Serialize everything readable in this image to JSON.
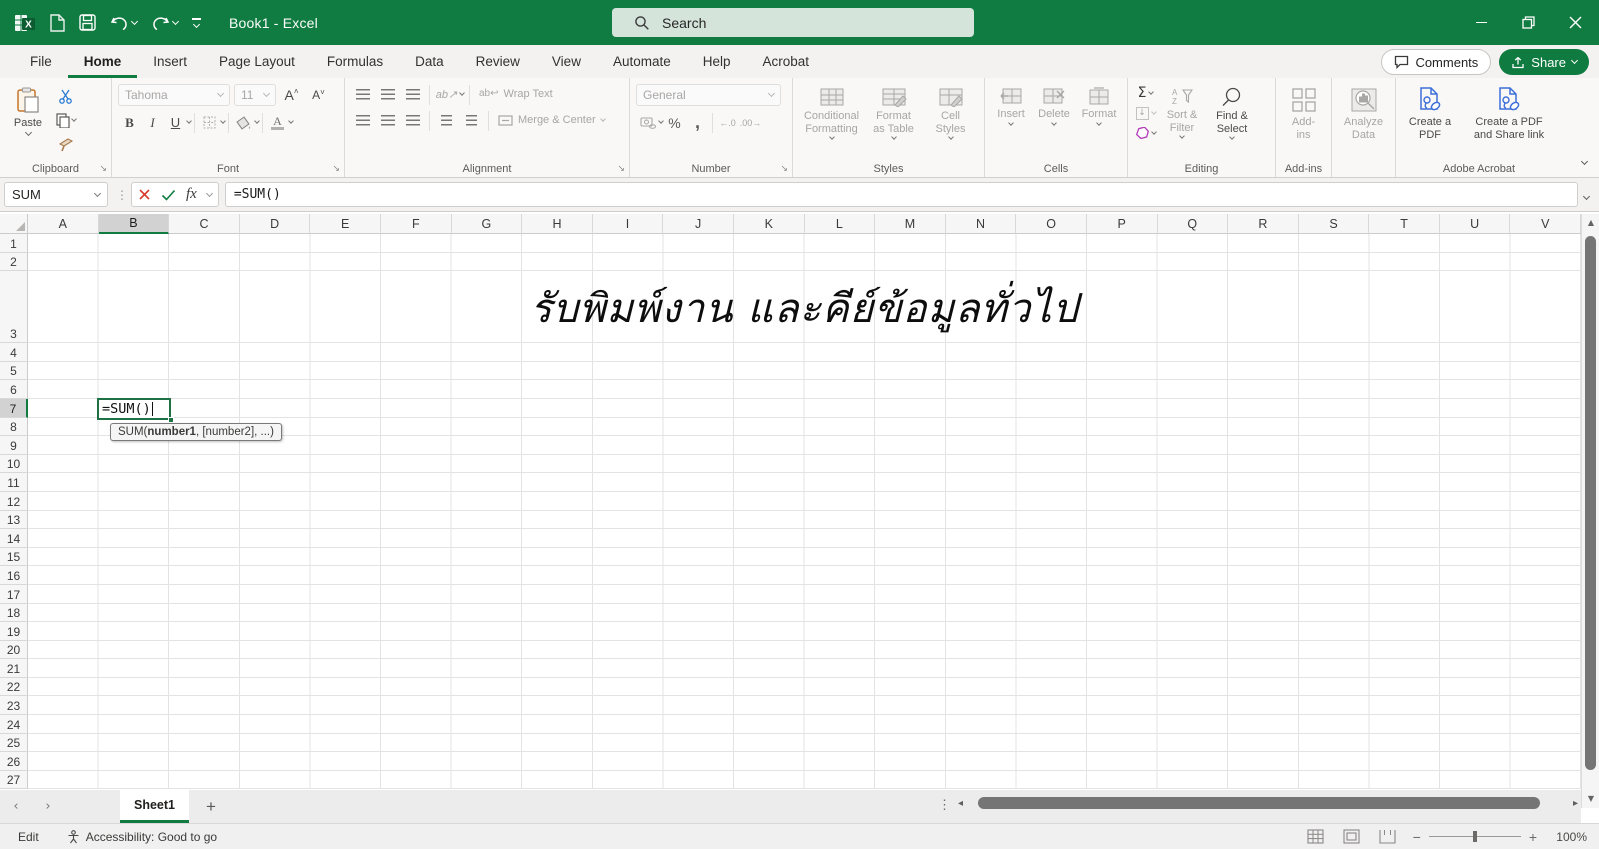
{
  "titlebar": {
    "title": "Book1 - Excel",
    "search_placeholder": "Search"
  },
  "ribbon_tabs": {
    "items": [
      "File",
      "Home",
      "Insert",
      "Page Layout",
      "Formulas",
      "Data",
      "Review",
      "View",
      "Automate",
      "Help",
      "Acrobat"
    ],
    "active": "Home"
  },
  "top_actions": {
    "comments": "Comments",
    "share": "Share"
  },
  "ribbon": {
    "clipboard": {
      "label": "Clipboard",
      "paste": "Paste"
    },
    "font": {
      "label": "Font",
      "family": "Tahoma",
      "size": "11",
      "bold": "B",
      "italic": "I",
      "underline": "U"
    },
    "alignment": {
      "label": "Alignment",
      "wrap": "Wrap Text",
      "merge": "Merge & Center"
    },
    "number": {
      "label": "Number",
      "format": "General",
      "percent": "%",
      "comma": ","
    },
    "styles": {
      "label": "Styles",
      "conditional": "Conditional Formatting",
      "format_table": "Format as Table",
      "cell_styles": "Cell Styles"
    },
    "cells": {
      "label": "Cells",
      "insert": "Insert",
      "delete": "Delete",
      "format": "Format"
    },
    "editing": {
      "label": "Editing",
      "autosum": "Σ",
      "sort_filter": "Sort & Filter",
      "find_select": "Find & Select"
    },
    "addins": {
      "label": "Add-ins",
      "button": "Add-ins"
    },
    "analyze": {
      "button": "Analyze Data"
    },
    "acrobat": {
      "label": "Adobe Acrobat",
      "create_pdf": "Create a PDF",
      "create_share": "Create a PDF and Share link"
    }
  },
  "formula_bar": {
    "name_box": "SUM",
    "fx": "fx",
    "formula": "=SUM()"
  },
  "grid": {
    "columns": [
      "A",
      "B",
      "C",
      "D",
      "E",
      "F",
      "G",
      "H",
      "I",
      "J",
      "K",
      "L",
      "M",
      "N",
      "O",
      "P",
      "Q",
      "R",
      "S",
      "T",
      "U",
      "V"
    ],
    "active_column": "B",
    "rows": [
      1,
      2,
      3,
      4,
      5,
      6,
      7,
      8,
      9,
      10,
      11,
      12,
      13,
      14,
      15,
      16,
      17,
      18,
      19,
      20,
      21,
      22,
      23,
      24,
      25,
      26,
      27
    ],
    "active_row": 7,
    "banner": "รับพิมพ์งาน และคีย์ข้อมูลทั่วไป",
    "edit_cell": {
      "ref": "B7",
      "value": "=SUM()"
    },
    "tooltip": {
      "pre": "SUM(",
      "bold": "number1",
      "post": ", [number2], ...)"
    }
  },
  "sheet_bar": {
    "active_tab": "Sheet1"
  },
  "status_bar": {
    "mode": "Edit",
    "accessibility": "Accessibility: Good to go",
    "zoom_level": "100%"
  },
  "colors": {
    "excel_green": "#107C41",
    "scroll_thumb": "#757575",
    "disabled_text": "#A8A6A4",
    "acrobat_blue": "#3E6FD8"
  }
}
